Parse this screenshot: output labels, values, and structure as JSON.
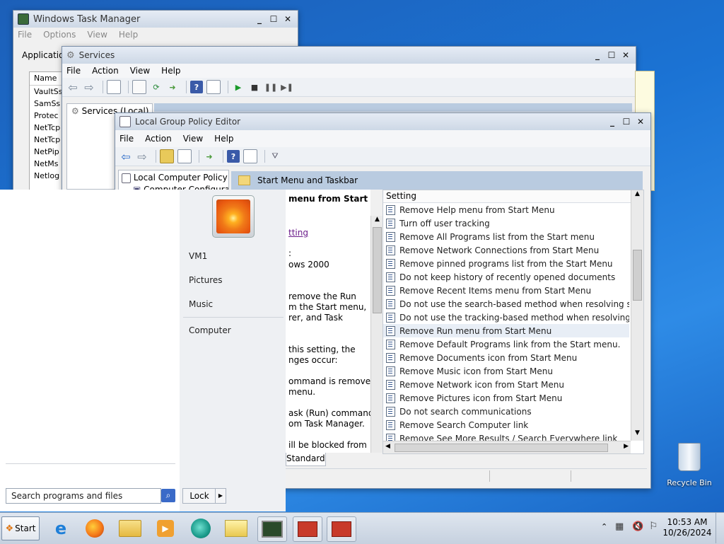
{
  "task_manager": {
    "title": "Windows Task Manager",
    "menu": [
      "File",
      "Options",
      "View",
      "Help"
    ],
    "tab": "Applicatio",
    "list_header": "Name",
    "rows": [
      "VaultSs",
      "SamSs",
      "Protec",
      "NetTcp",
      "NetTcp",
      "NetPip",
      "NetMs",
      "Netlog"
    ]
  },
  "services": {
    "title": "Services",
    "menu": [
      "File",
      "Action",
      "View",
      "Help"
    ],
    "tree_item": "Services (Local)"
  },
  "gpedit": {
    "title": "Local Group Policy Editor",
    "menu": [
      "File",
      "Action",
      "View",
      "Help"
    ],
    "tree": [
      "Local Computer Policy",
      "Computer Configura"
    ],
    "folder_header": "Start Menu and Taskbar",
    "desc_lines": [
      "menu from Start",
      "tting",
      ":",
      "ows 2000",
      "remove the Run",
      "m the Start menu,",
      "rer, and Task",
      "this setting, the",
      "nges occur:",
      "ommand is removed",
      "menu.",
      "ask (Run) command",
      "om Task Manager.",
      "ill be blocked from"
    ],
    "column_header": "Setting",
    "settings": [
      "Remove Help menu from Start Menu",
      "Turn off user tracking",
      "Remove All Programs list from the Start menu",
      "Remove Network Connections from Start Menu",
      "Remove pinned programs list from the Start Menu",
      "Do not keep history of recently opened documents",
      "Remove Recent Items menu from Start Menu",
      "Do not use the search-based method when resolving shell s...",
      "Do not use the tracking-based method when resolving shell ...",
      "Remove Run menu from Start Menu",
      "Remove Default Programs link from the Start menu.",
      "Remove Documents icon from Start Menu",
      "Remove Music icon from Start Menu",
      "Remove Network icon from Start Menu",
      "Remove Pictures icon from Start Menu",
      "Do not search communications",
      "Remove Search Computer link",
      "Remove See More Results / Search Everywhere link"
    ],
    "selected_index": 9,
    "tab": "Standard"
  },
  "start_menu": {
    "right_items": [
      "VM1",
      "Pictures",
      "Music",
      "Computer"
    ],
    "search_placeholder": "Search programs and files",
    "lock_label": "Lock"
  },
  "desktop": {
    "recycle_bin": "Recycle Bin"
  },
  "taskbar": {
    "start_label": "Start",
    "time": "10:53 AM",
    "date": "10/26/2024"
  },
  "colors": {
    "selection": "#e8eef6",
    "folder_header_bg": "#b9cbe0",
    "link": "#6a1b8a"
  }
}
